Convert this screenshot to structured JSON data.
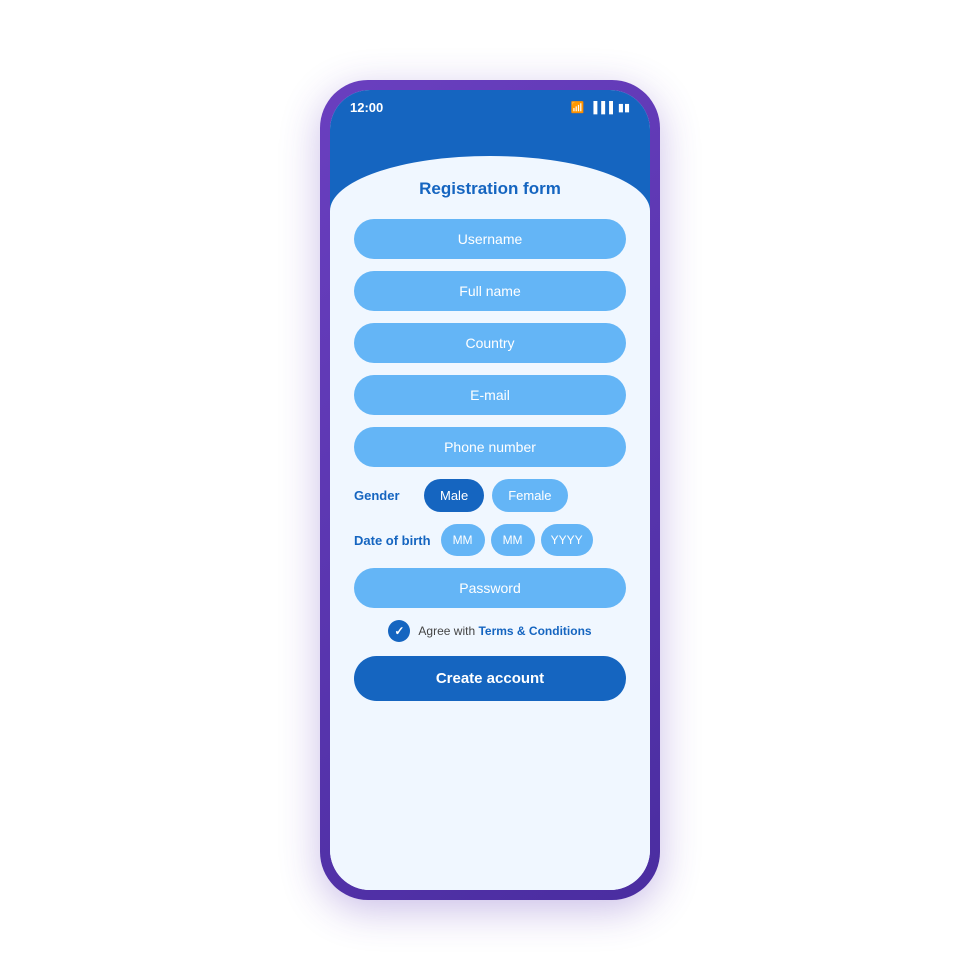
{
  "status_bar": {
    "time": "12:00",
    "wifi_icon": "wifi",
    "signal_icon": "signal",
    "battery_icon": "battery"
  },
  "header": {
    "title": "Registration form"
  },
  "form": {
    "username_placeholder": "Username",
    "fullname_placeholder": "Full name",
    "country_placeholder": "Country",
    "email_placeholder": "E-mail",
    "phone_placeholder": "Phone number",
    "gender_label": "Gender",
    "gender_male": "Male",
    "gender_female": "Female",
    "dob_label": "Date of birth",
    "dob_month1": "MM",
    "dob_month2": "MM",
    "dob_year": "YYYY",
    "password_placeholder": "Password",
    "terms_prefix": "Agree with ",
    "terms_link": "Terms & Conditions",
    "create_button": "Create account"
  },
  "colors": {
    "primary": "#1565c0",
    "field_bg": "#64b5f6",
    "bg": "#f0f7ff"
  }
}
